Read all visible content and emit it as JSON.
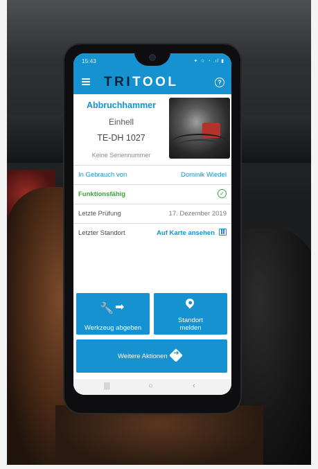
{
  "statusbar": {
    "time": "15:43",
    "left_icons": "⚡ ▮",
    "right_icons": "✦ ☆ ◔ .ıl ▮"
  },
  "app": {
    "logo_dark": "TRI",
    "logo_light": "TOOL",
    "help": "?"
  },
  "tool": {
    "name": "Abbruchhammer",
    "brand": "Einhell",
    "model": "TE-DH 1027",
    "serial": "Keine Seriennummer"
  },
  "rows": {
    "in_use_label": "In Gebrauch von",
    "in_use_value": "Dominik Wiedel",
    "status_label": "Funktionsfähig",
    "status_icon": "✓",
    "last_check_label": "Letzte Prüfung",
    "last_check_value": "17. Dezember 2019",
    "last_location_label": "Letzter Standort",
    "last_location_link": "Auf Karte ansehen"
  },
  "actions": {
    "return_label": "Werkzeug abgeben",
    "report_line1": "Standort",
    "report_line2": "melden",
    "more_label": "Weitere Aktionen"
  },
  "icons": {
    "wrench": "🔧",
    "arrow": "➡"
  },
  "navbar": {
    "recent": "|||",
    "home": "○",
    "back": "‹"
  },
  "colors": {
    "primary": "#1592cf",
    "ok": "#3aa33a",
    "logo_dark": "#0b2136"
  }
}
